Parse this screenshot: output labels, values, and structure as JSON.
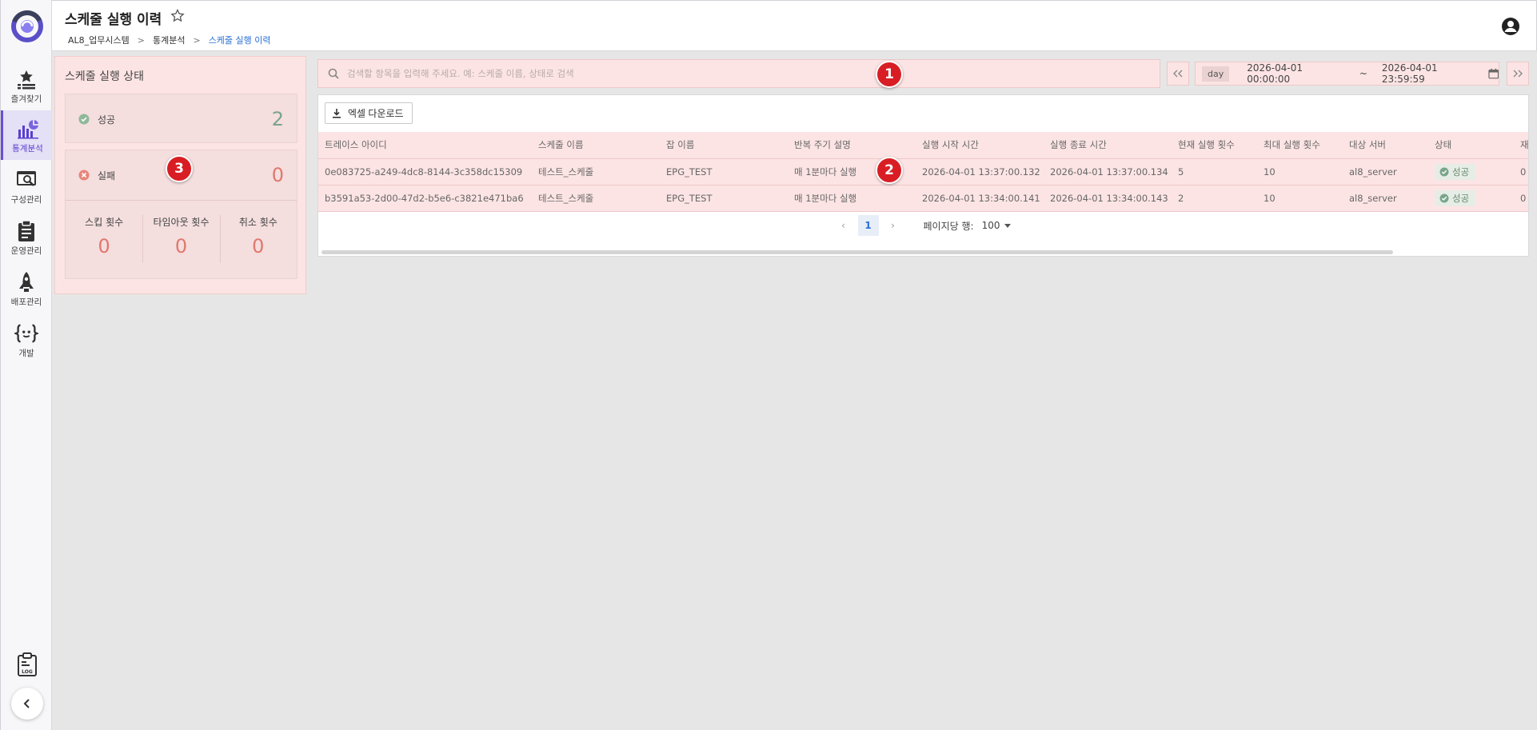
{
  "nav": {
    "items": [
      {
        "label": "즐겨찾기",
        "icon": "star-list-icon"
      },
      {
        "label": "통계분석",
        "icon": "chart-icon"
      },
      {
        "label": "구성관리",
        "icon": "config-search-icon"
      },
      {
        "label": "운영관리",
        "icon": "clipboard-icon"
      },
      {
        "label": "배포관리",
        "icon": "rocket-icon"
      },
      {
        "label": "개발",
        "icon": "code-braces-icon"
      }
    ]
  },
  "header": {
    "title": "스케줄 실행 이력",
    "breadcrumb": [
      "AL8_업무시스템",
      "통계분석",
      "스케줄 실행 이력"
    ]
  },
  "status_panel": {
    "title": "스케줄 실행 상태",
    "success_label": "성공",
    "success_count": "2",
    "fail_label": "실패",
    "fail_count": "0",
    "stats": [
      {
        "label": "스킵 횟수",
        "value": "0"
      },
      {
        "label": "타임아웃 횟수",
        "value": "0"
      },
      {
        "label": "취소 횟수",
        "value": "0"
      }
    ]
  },
  "search": {
    "placeholder": "검색할 항목을 입력해 주세요. 예: 스케줄 이름, 상태로 검색"
  },
  "date_range": {
    "unit": "day",
    "from": "2026-04-01 00:00:00",
    "separator": "~",
    "to": "2026-04-01 23:59:59"
  },
  "toolbar": {
    "excel_label": "엑셀 다운로드"
  },
  "table": {
    "columns": [
      "트레이스 아이디",
      "스케줄 이름",
      "잡 이름",
      "반복 주기 설명",
      "실행 시작 시간",
      "실행 종료 시간",
      "현재 실행 횟수",
      "최대 실행 횟수",
      "대상 서버",
      "상태",
      "재"
    ],
    "rows": [
      [
        "0e083725-a249-4dc8-8144-3c358dc15309",
        "테스트_스케줄",
        "EPG_TEST",
        "매 1분마다 실행",
        "2026-04-01 13:37:00.132",
        "2026-04-01 13:37:00.134",
        "5",
        "10",
        "al8_server",
        "성공",
        "0"
      ],
      [
        "b3591a53-2d00-47d2-b5e6-c3821e471ba6",
        "테스트_스케줄",
        "EPG_TEST",
        "매 1분마다 실행",
        "2026-04-01 13:34:00.141",
        "2026-04-01 13:34:00.143",
        "2",
        "10",
        "al8_server",
        "성공",
        "0"
      ]
    ]
  },
  "pager": {
    "current_page": "1",
    "rows_per_page_label": "페이지당 행:",
    "rows_per_page": "100"
  },
  "markers": [
    "1",
    "2",
    "3"
  ],
  "colors": {
    "accent": "#6a4fd8",
    "link": "#2a6fd6",
    "highlight": "#fde4e4",
    "marker": "#d81e24",
    "success": "#7aa58a",
    "fail": "#e0786d"
  }
}
